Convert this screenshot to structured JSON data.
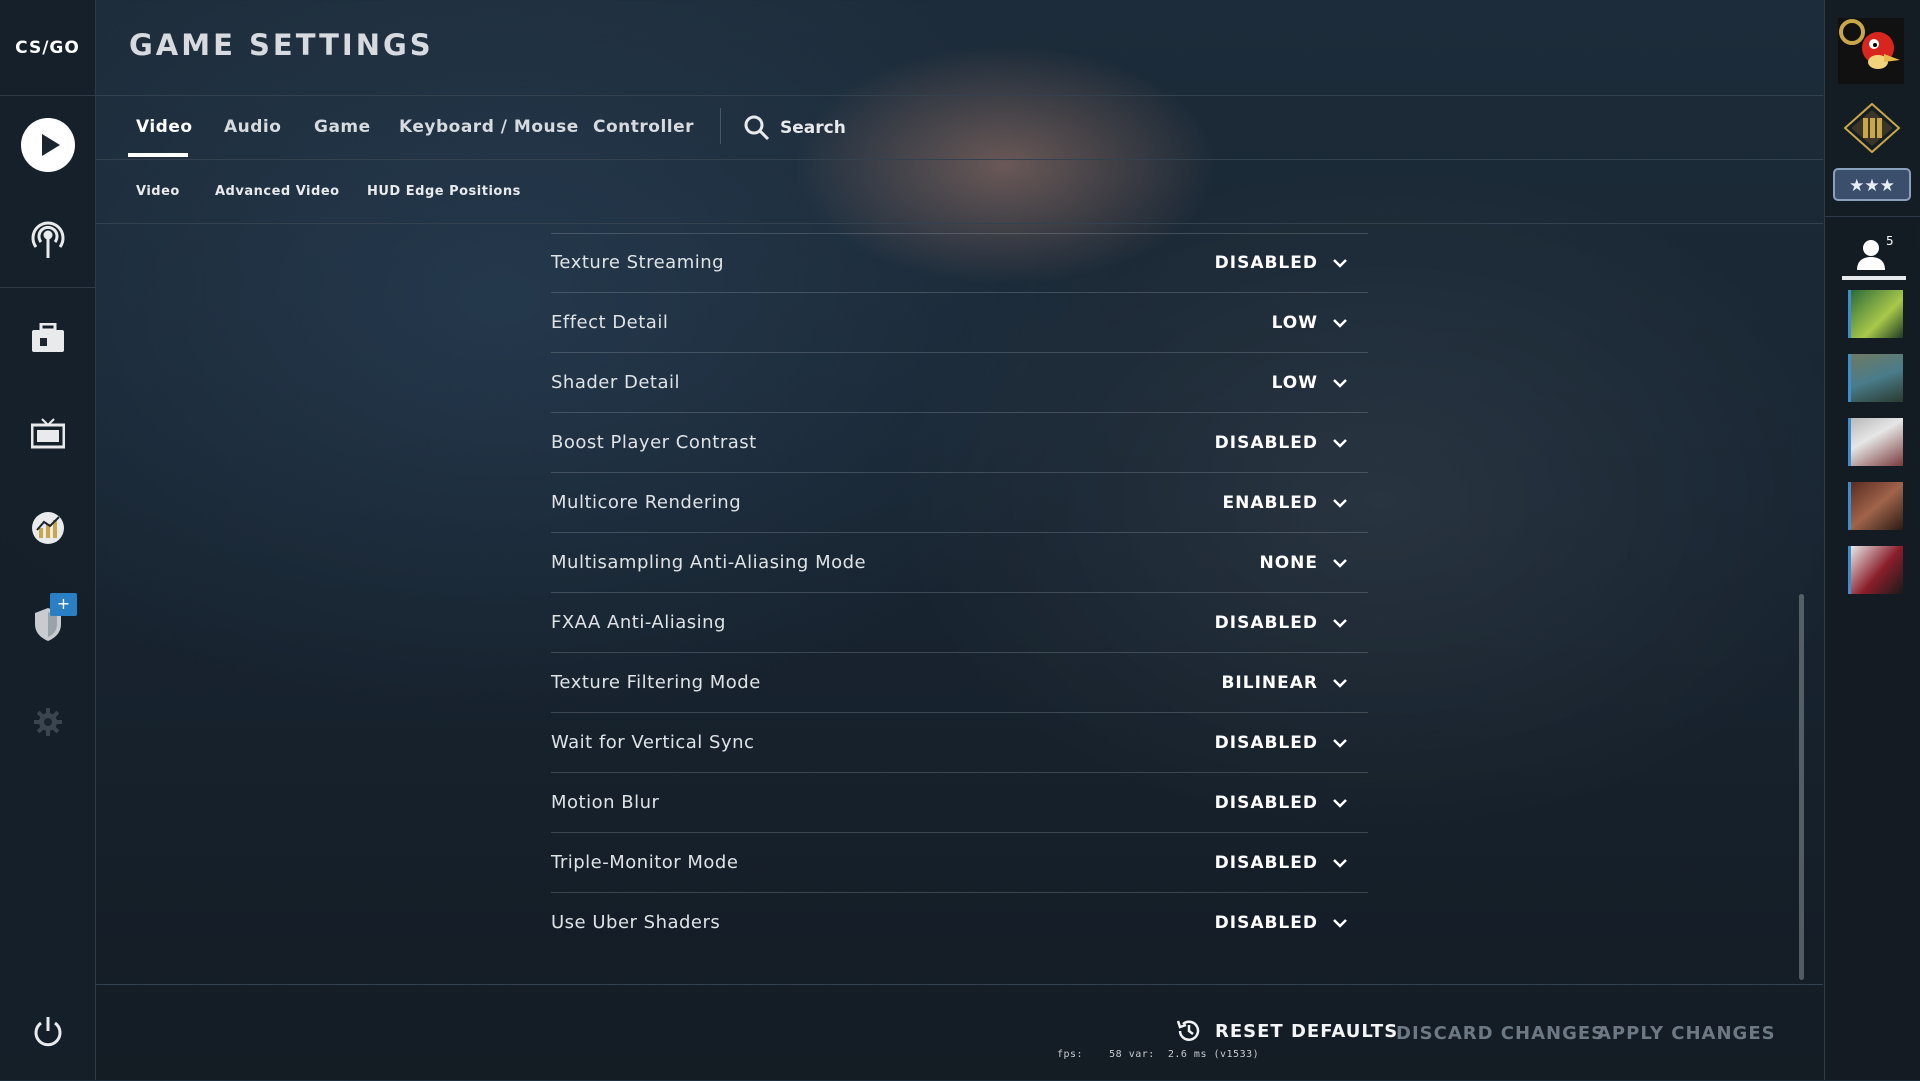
{
  "app": {
    "logo_text": "CS/GO",
    "title": "GAME SETTINGS"
  },
  "left_nav": {
    "items": [
      {
        "icon": "play-icon"
      },
      {
        "icon": "broadcast-icon"
      },
      {
        "icon": "inventory-icon"
      },
      {
        "icon": "watch-tv-icon"
      },
      {
        "icon": "stats-icon"
      },
      {
        "icon": "shield-icon",
        "badge": "+"
      },
      {
        "icon": "gear-icon"
      },
      {
        "icon": "power-icon"
      }
    ]
  },
  "tabs": [
    {
      "label": "Video",
      "active": true
    },
    {
      "label": "Audio"
    },
    {
      "label": "Game"
    },
    {
      "label": "Keyboard / Mouse"
    },
    {
      "label": "Controller"
    }
  ],
  "search": {
    "label": "Search",
    "icon": "search-icon"
  },
  "subtabs": [
    {
      "label": "Video"
    },
    {
      "label": "Advanced Video"
    },
    {
      "label": "HUD Edge Positions"
    }
  ],
  "settings": [
    {
      "label": "Texture Streaming",
      "value": "DISABLED"
    },
    {
      "label": "Effect Detail",
      "value": "LOW"
    },
    {
      "label": "Shader Detail",
      "value": "LOW"
    },
    {
      "label": "Boost Player Contrast",
      "value": "DISABLED"
    },
    {
      "label": "Multicore Rendering",
      "value": "ENABLED"
    },
    {
      "label": "Multisampling Anti-Aliasing Mode",
      "value": "NONE"
    },
    {
      "label": "FXAA Anti-Aliasing",
      "value": "DISABLED"
    },
    {
      "label": "Texture Filtering Mode",
      "value": "BILINEAR"
    },
    {
      "label": "Wait for Vertical Sync",
      "value": "DISABLED"
    },
    {
      "label": "Motion Blur",
      "value": "DISABLED"
    },
    {
      "label": "Triple-Monitor Mode",
      "value": "DISABLED"
    },
    {
      "label": "Use Uber Shaders",
      "value": "DISABLED"
    }
  ],
  "footer": {
    "reset": "RESET DEFAULTS",
    "discard": "DISCARD CHANGES",
    "apply": "APPLY CHANGES",
    "fps_readout": "fps:    58 var:  2.6 ms (v1533)"
  },
  "right_panel": {
    "friends_count": "5",
    "colors": {
      "accent": "#3c8ed0",
      "rank_gold": "#c9a64a"
    }
  }
}
